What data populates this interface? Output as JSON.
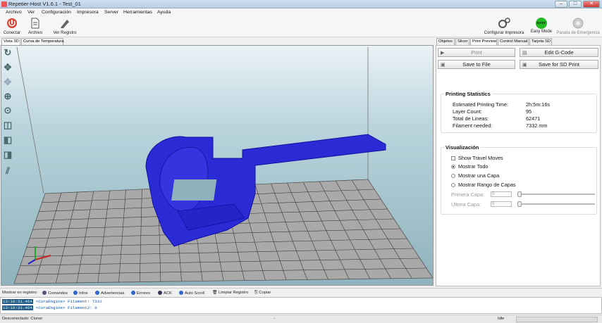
{
  "window": {
    "title": "Repetier-Host V1.6.1 - Test_01"
  },
  "menu": [
    "Archivo",
    "Ver",
    "Configuración",
    "Impresora",
    "Server",
    "Herramientas",
    "Ayuda"
  ],
  "toolbar": {
    "connect": "Conectar",
    "file": "Archivo",
    "log": "Ver Registro",
    "config_printer": "Configurar Impresora",
    "easy_mode": "Easy Mode",
    "easy_badge": "EASY",
    "emergency": "Parada de Emergencia"
  },
  "left_tabs": [
    "Vista 3D",
    "Curva de Temperatura"
  ],
  "right_tabs": [
    "Objetos",
    "Slicer",
    "Print Preview",
    "Control Manual",
    "Tarjeta SD"
  ],
  "actions": {
    "print": "Print",
    "edit_gcode": "Edit G-Code",
    "save_file": "Save to File",
    "save_sd": "Save for SD Print"
  },
  "stats": {
    "title": "Printing Statistics",
    "rows": [
      {
        "label": "Estimated Printing Time:",
        "value": "2h:5m:16s"
      },
      {
        "label": "Layer Count:",
        "value": "95"
      },
      {
        "label": "Total de Lineas:",
        "value": "62471"
      },
      {
        "label": "Filament needed:",
        "value": "7332 mm"
      }
    ]
  },
  "visual": {
    "title": "Visualización",
    "show_travel": "Show Travel Moves",
    "show_all": "Mostrar Todo",
    "show_one": "Mostrar una Capa",
    "show_range": "Mostrar Rango de Capas",
    "first_layer": "Primera Capa:",
    "last_layer": "Última Capa:",
    "first_value": "0",
    "last_value": "0"
  },
  "logbar": {
    "show_label": "Mostrar en registro:",
    "commands": "Comandos",
    "infos": "Infos",
    "warnings": "Advertencias",
    "errors": "Errores",
    "ack": "ACK",
    "autoscroll": "Auto Scroll",
    "clear": "Limpiar Registro",
    "copy": "Copiar"
  },
  "log": [
    {
      "time": "13:10:31.464",
      "msg": "<CuraEngine> Filament: 7331"
    },
    {
      "time": "13:10:31.464",
      "msg": "<CuraEngine> Filament2: 0"
    }
  ],
  "status": {
    "left": "Desconectado: Cloner",
    "mid": "-",
    "right": "Idle"
  },
  "colors": {
    "accent": "#2244cc",
    "easy": "#22bb22",
    "bed": "#a9a9a9",
    "model": "#2b2bd6"
  }
}
